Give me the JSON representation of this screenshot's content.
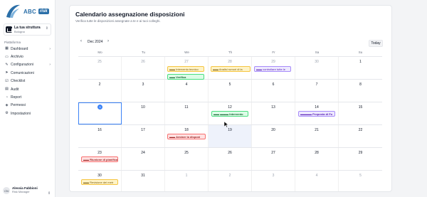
{
  "app": {
    "name": "ABC",
    "badge": "risk"
  },
  "structure": {
    "title": "La tua struttura",
    "subtitle": "Bologna"
  },
  "sidebar": {
    "section": "Piattaforma",
    "items": [
      {
        "label": "Dashboard",
        "icon": "grid-icon",
        "has_chevron": true
      },
      {
        "label": "Archivio",
        "icon": "archive-icon",
        "has_chevron": false
      },
      {
        "label": "Configurazioni",
        "icon": "wrench-icon",
        "has_chevron": true
      },
      {
        "label": "Comunicazioni",
        "icon": "send-icon",
        "has_chevron": false
      },
      {
        "label": "Checklist",
        "icon": "checklist-icon",
        "has_chevron": false
      },
      {
        "label": "Audit",
        "icon": "audit-icon",
        "has_chevron": false
      },
      {
        "label": "Report",
        "icon": "report-icon",
        "has_chevron": false
      },
      {
        "label": "Permessi",
        "icon": "shield-icon",
        "has_chevron": false
      },
      {
        "label": "Impostazioni",
        "icon": "gear-icon",
        "has_chevron": false
      }
    ]
  },
  "user": {
    "initials": "CN",
    "name": "Alessia Fabbioni",
    "role": "Risk Manager"
  },
  "page": {
    "title": "Calendario assegnazione disposizioni",
    "subtitle": "Verifica tutte le disposizioni assegnate a te e ai tuoi colleghi."
  },
  "toolbar": {
    "prev": "‹",
    "next": "›",
    "month": "Dec 2024",
    "today": "Today"
  },
  "calendar": {
    "weekdays": [
      "Mo",
      "Tu",
      "We",
      "Th",
      "Fr",
      "Sa",
      "Su"
    ],
    "weeks": [
      [
        "25",
        "26",
        "27",
        "28",
        "29",
        "30",
        "1"
      ],
      [
        "2",
        "3",
        "4",
        "5",
        "6",
        "7",
        "8"
      ],
      [
        "9",
        "10",
        "11",
        "12",
        "13",
        "14",
        "15"
      ],
      [
        "16",
        "17",
        "18",
        "19",
        "20",
        "21",
        "22"
      ],
      [
        "23",
        "24",
        "25",
        "26",
        "27",
        "28",
        "29"
      ],
      [
        "30",
        "31",
        "1",
        "2",
        "3",
        "4",
        "5"
      ]
    ],
    "today": "9",
    "events": [
      {
        "label": "Intervento tecnico",
        "color": "yellow"
      },
      {
        "label": "Analisi rumori di la",
        "color": "yellow"
      },
      {
        "label": "controllare tutte le",
        "color": "purple"
      },
      {
        "label": "Verifica",
        "color": "green"
      },
      {
        "label": "Intervento",
        "color": "green"
      },
      {
        "label": "Proposta di Fo",
        "color": "purple"
      },
      {
        "label": "Avviare la disponi",
        "color": "red"
      },
      {
        "label": "Riunione di pianifica",
        "color": "red"
      },
      {
        "label": "Revisione dei metr",
        "color": "yellow"
      }
    ]
  },
  "colors": {
    "accent": "#3b82f6",
    "brand": "#2b6fa8"
  }
}
